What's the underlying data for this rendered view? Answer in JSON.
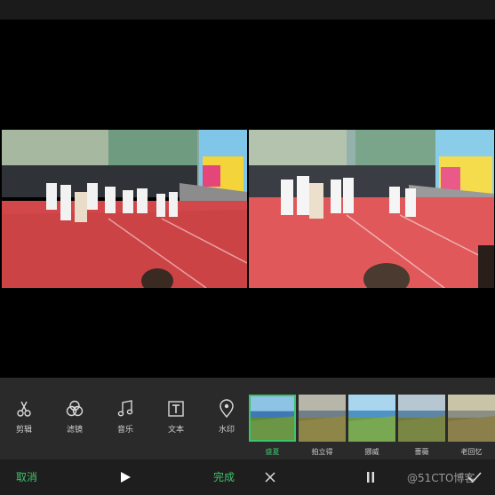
{
  "preview": {
    "description_icon": "video-preview"
  },
  "toolbar": {
    "items": [
      {
        "label": "剪辑",
        "icon": "scissors-icon"
      },
      {
        "label": "滤镜",
        "icon": "filter-circles-icon"
      },
      {
        "label": "音乐",
        "icon": "music-note-icon"
      },
      {
        "label": "文本",
        "icon": "text-icon"
      },
      {
        "label": "水印",
        "icon": "location-pin-icon"
      }
    ]
  },
  "filters": {
    "items": [
      {
        "label": "盛夏",
        "selected": true
      },
      {
        "label": "拍立得",
        "selected": false
      },
      {
        "label": "挪威",
        "selected": false
      },
      {
        "label": "蔷薇",
        "selected": false
      },
      {
        "label": "老回忆",
        "selected": false
      }
    ]
  },
  "bottombar": {
    "cancel_label": "取消",
    "done_label": "完成",
    "watermark": "@51CTO博客"
  },
  "colors": {
    "accent": "#3ec36a",
    "toolbar_bg": "#2a2a2a",
    "bottombar_bg": "#1e1e1e"
  }
}
